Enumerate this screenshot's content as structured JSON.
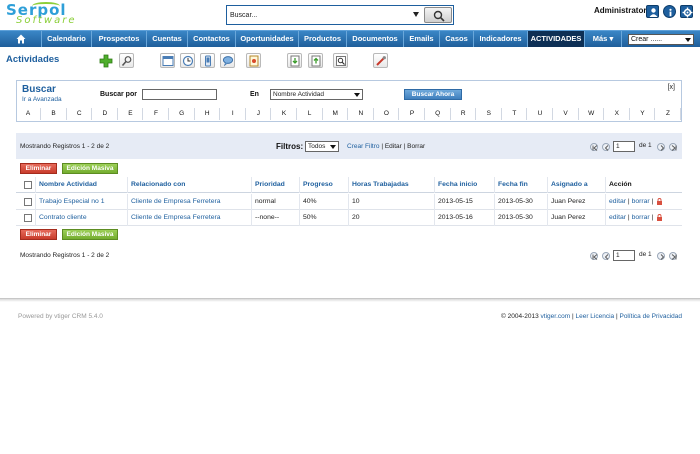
{
  "brand": {
    "logo_top": "Serpol",
    "logo_bottom": "Software"
  },
  "header": {
    "search_value": "Buscar...",
    "user_name": "Administrator",
    "icons": [
      "user-icon",
      "info-icon",
      "settings-icon"
    ]
  },
  "nav": {
    "home_icon": "home-icon",
    "items": [
      {
        "label": "Calendario"
      },
      {
        "label": "Prospectos"
      },
      {
        "label": "Cuentas"
      },
      {
        "label": "Contactos"
      },
      {
        "label": "Oportunidades"
      },
      {
        "label": "Productos"
      },
      {
        "label": "Documentos"
      },
      {
        "label": "Emails"
      },
      {
        "label": "Casos"
      },
      {
        "label": "Indicadores"
      },
      {
        "label": "ACTIVIDADES"
      },
      {
        "label": "Más ▾"
      }
    ],
    "active": "ACTIVIDADES",
    "create_select": "Crear ......"
  },
  "module": {
    "title": "Actividades"
  },
  "toolbar_icons": [
    "add-icon",
    "search-tool-icon",
    "calendar-view-icon",
    "clock-icon",
    "mobile-icon",
    "chat-icon",
    "settings-doc-icon",
    "import-icon",
    "export-icon",
    "find-duplicates-icon",
    "tools-icon"
  ],
  "search": {
    "title": "Buscar",
    "advanced": "Ir a Avanzada",
    "by_label": "Buscar por",
    "in_label": "En",
    "field_select": "Nombre Actividad",
    "go_button": "Buscar Ahora",
    "close": "[x]",
    "letters": [
      "A",
      "B",
      "C",
      "D",
      "E",
      "F",
      "G",
      "H",
      "I",
      "J",
      "K",
      "L",
      "M",
      "N",
      "O",
      "P",
      "Q",
      "R",
      "S",
      "T",
      "U",
      "V",
      "W",
      "X",
      "Y",
      "Z"
    ]
  },
  "list": {
    "record_count": "Mostrando Registros 1 - 2 de 2",
    "filter_label": "Filtros:",
    "filter_value": "Todos",
    "create_filter": "Crear Filtro",
    "edit": "Editar",
    "delete": "Borrar",
    "page_value": "1",
    "of_pages": "de 1",
    "delete_button": "Eliminar",
    "mass_edit_button": "Edición Masiva",
    "columns": [
      "Nombre Actividad",
      "Relacionado con",
      "Prioridad",
      "Progreso",
      "Horas Trabajadas",
      "Fecha inicio",
      "Fecha fin",
      "Asignado a",
      "Acción"
    ],
    "rows": [
      {
        "name": "Trabajo Especial no 1",
        "related": "Cliente de Empresa Ferretera",
        "priority": "normal",
        "progress": "40%",
        "hours": "10",
        "start": "2013-05-15",
        "end": "2013-05-30",
        "assigned": "Juan Perez",
        "edit": "editar",
        "delete": "borrar"
      },
      {
        "name": "Contrato cliente",
        "related": "Cliente de Empresa Ferretera",
        "priority": "--none--",
        "progress": "50%",
        "hours": "20",
        "start": "2013-05-16",
        "end": "2013-05-30",
        "assigned": "Juan Perez",
        "edit": "editar",
        "delete": "borrar"
      }
    ]
  },
  "footer": {
    "powered": "Powered by vtiger CRM 5.4.0",
    "copyright": "© 2004-2013",
    "vtiger_link": "vtiger.com",
    "license_link": "Leer Licencia",
    "privacy_link": "Política de Privacidad",
    "sep": "|"
  },
  "colors": {
    "nav_bg": "#2a73b5",
    "nav_active": "#0d2f55",
    "link": "#1e5f9e",
    "delete_btn": "#d9503f",
    "mass_edit_btn": "#86bd3f",
    "band": "#e6ebf5"
  }
}
